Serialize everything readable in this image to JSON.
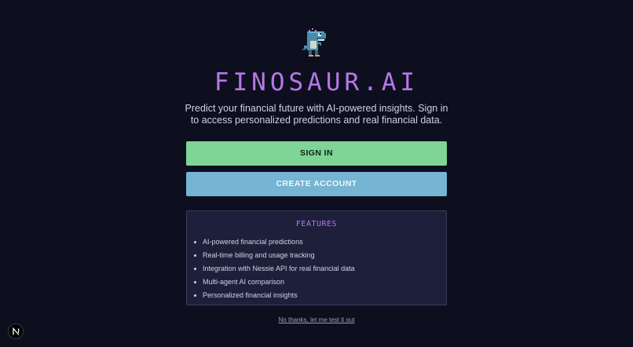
{
  "brand": {
    "title": "FINOSAUR.AI",
    "logo_icon": "pixel-dinosaur-icon",
    "accent_color": "#b777e8"
  },
  "intro": {
    "tagline": "Predict your financial future with AI-powered insights. Sign in to access personalized predictions and real financial data."
  },
  "actions": {
    "sign_in_label": "SIGN IN",
    "sign_in_color": "#7ed595",
    "create_account_label": "CREATE ACCOUNT",
    "create_account_color": "#75b4d2"
  },
  "features": {
    "title": "FEATURES",
    "items": [
      "AI-powered financial predictions",
      "Real-time billing and usage tracking",
      "Integration with Nessie API for real financial data",
      "Multi-agent AI comparison",
      "Personalized financial insights"
    ]
  },
  "skip": {
    "label": "No thanks, let me test it out"
  },
  "dev_badge": {
    "icon": "nextjs-logo-icon",
    "letter": "N"
  }
}
